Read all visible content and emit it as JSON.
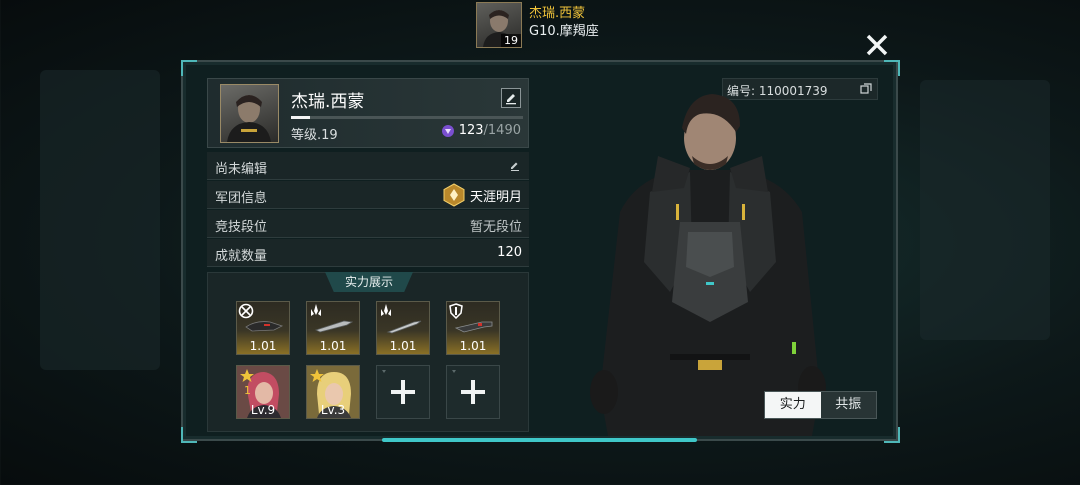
{
  "header": {
    "player_name": "杰瑞.西蒙",
    "player_level": "19",
    "server": "G10.摩羯座"
  },
  "profile": {
    "name": "杰瑞.西蒙",
    "level_label": "等级.19",
    "xp_fraction": 0.08,
    "stamina_current": "123",
    "stamina_max": "/1490",
    "id_label": "编号: 110001739"
  },
  "info_rows": [
    {
      "label": "尚未编辑",
      "value": ""
    },
    {
      "label": "军团信息",
      "value": "天涯明月"
    },
    {
      "label": "竞技段位",
      "value": "暂无段位"
    },
    {
      "label": "成就数量",
      "value": "120"
    }
  ],
  "showcase": {
    "title": "实力展示",
    "equipment": [
      {
        "icon": "crosshair-badge-icon",
        "value": "1.01"
      },
      {
        "icon": "spire-badge-icon",
        "value": "1.01"
      },
      {
        "icon": "spire-badge-icon",
        "value": "1.01"
      },
      {
        "icon": "shield-badge-icon",
        "value": "1.01"
      }
    ],
    "heroes": [
      {
        "level": "Lv.9",
        "stars": "1"
      },
      {
        "level": "Lv.3",
        "stars": ""
      }
    ]
  },
  "toggle": {
    "options": [
      "实力",
      "共振"
    ],
    "selected": "实力"
  },
  "colors": {
    "accent_cyan": "#3fc7c8",
    "name_gold": "#f0c33a",
    "slot_gold": "#8a7026"
  }
}
